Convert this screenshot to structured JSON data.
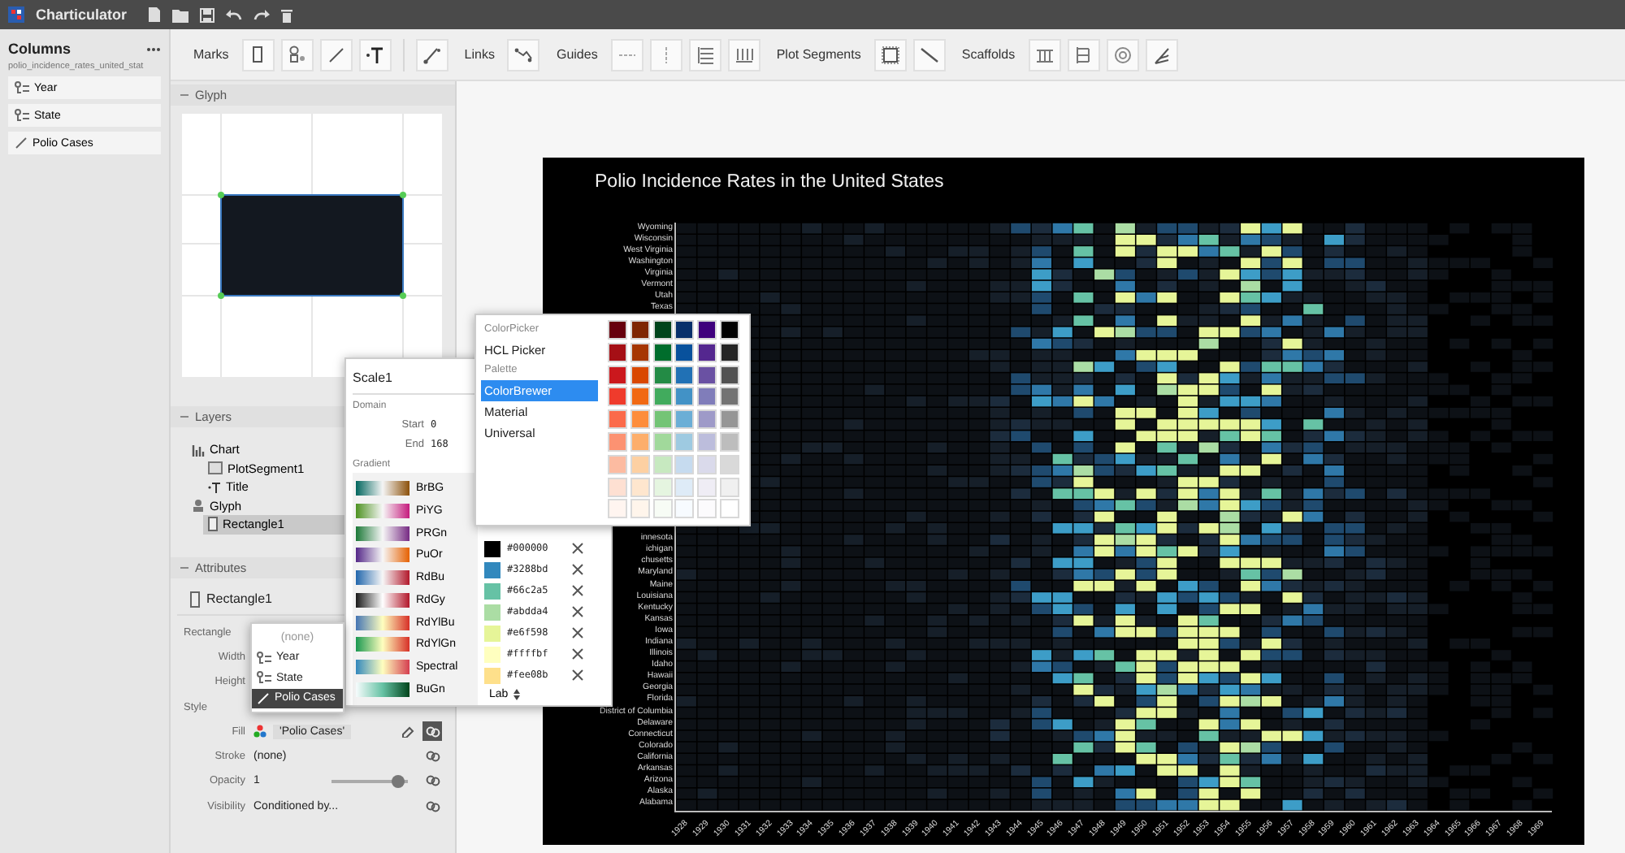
{
  "app": {
    "title": "Charticulator"
  },
  "columns_panel": {
    "title": "Columns",
    "dataset": "polio_incidence_rates_united_stat",
    "columns": [
      {
        "name": "Year",
        "kind": "categorical"
      },
      {
        "name": "State",
        "kind": "categorical"
      },
      {
        "name": "Polio Cases",
        "kind": "numerical"
      }
    ]
  },
  "toolbar": {
    "groups": [
      "Marks",
      "Links",
      "Guides",
      "Plot Segments",
      "Scaffolds"
    ]
  },
  "glyph_panel": {
    "title": "Glyph"
  },
  "layers_panel": {
    "title": "Layers",
    "items": [
      {
        "label": "Chart",
        "kind": "chart",
        "selected": false,
        "children": [
          {
            "label": "PlotSegment1",
            "kind": "plot-segment",
            "selected": false
          },
          {
            "label": "Title",
            "kind": "text",
            "selected": false
          }
        ]
      },
      {
        "label": "Glyph",
        "kind": "glyph",
        "selected": false,
        "children": [
          {
            "label": "Rectangle1",
            "kind": "rectangle",
            "selected": true
          }
        ]
      }
    ]
  },
  "attributes_panel": {
    "title": "Attributes",
    "object": "Rectangle1",
    "rows": [
      {
        "label": "Rectangle",
        "kind": "group"
      },
      {
        "label": "Width",
        "kind": "field"
      },
      {
        "label": "Height",
        "kind": "field"
      },
      {
        "label": "Style",
        "kind": "group"
      },
      {
        "label": "Fill",
        "kind": "mapping",
        "value": "'Polio Cases'",
        "bound": true
      },
      {
        "label": "Stroke",
        "kind": "text",
        "value": "(none)",
        "bound": false
      },
      {
        "label": "Opacity",
        "kind": "slider",
        "value": "1",
        "level": 0.88,
        "bound": false
      },
      {
        "label": "Visibility",
        "kind": "text",
        "value": "Conditioned by...",
        "bound": false
      }
    ]
  },
  "column_menu": {
    "items": [
      {
        "label": "(none)",
        "kind": "none",
        "selected": false
      },
      {
        "label": "Year",
        "kind": "categorical",
        "selected": false
      },
      {
        "label": "State",
        "kind": "categorical",
        "selected": false
      },
      {
        "label": "Polio Cases",
        "kind": "numerical",
        "selected": true
      }
    ]
  },
  "scale_editor": {
    "title": "Scale1",
    "domain_label": "Domain",
    "start_label": "Start",
    "start": "0",
    "end_label": "End",
    "end": "168",
    "gradient_label": "Gradient",
    "gradients": [
      {
        "name": "BrBG"
      },
      {
        "name": "PiYG"
      },
      {
        "name": "PRGn"
      },
      {
        "name": "PuOr"
      },
      {
        "name": "RdBu"
      },
      {
        "name": "RdGy"
      },
      {
        "name": "RdYlBu"
      },
      {
        "name": "RdYlGn"
      },
      {
        "name": "Spectral"
      },
      {
        "name": "BuGn"
      }
    ],
    "stops": [
      {
        "label": "#000000",
        "color": "#000000"
      },
      {
        "label": "#3288bd",
        "color": "#3288bd"
      },
      {
        "label": "#66c2a5",
        "color": "#66c2a5"
      },
      {
        "label": "#abdda4",
        "color": "#abdda4"
      },
      {
        "label": "#e6f598",
        "color": "#e6f598"
      },
      {
        "label": "#ffffbf",
        "color": "#ffffbf"
      },
      {
        "label": "#fee08b",
        "color": "#fee08b"
      }
    ],
    "interpolation": "Lab"
  },
  "color_picker": {
    "menu": [
      {
        "label": "ColorPicker",
        "kind": "header"
      },
      {
        "label": "HCL Picker",
        "kind": "item",
        "selected": false
      },
      {
        "label": "Palette",
        "kind": "header"
      },
      {
        "label": "ColorBrewer",
        "kind": "item",
        "selected": true
      },
      {
        "label": "Material",
        "kind": "item",
        "selected": false
      },
      {
        "label": "Universal",
        "kind": "item",
        "selected": false
      }
    ],
    "rows": [
      {
        "swatches": [
          {
            "color": "#67000d"
          },
          {
            "color": "#7f2704"
          },
          {
            "color": "#00441b"
          },
          {
            "color": "#08306b"
          },
          {
            "color": "#3f007d"
          },
          {
            "color": "#000000"
          }
        ]
      },
      {
        "swatches": [
          {
            "color": "#a50f15"
          },
          {
            "color": "#a63603"
          },
          {
            "color": "#006d2c"
          },
          {
            "color": "#08519c"
          },
          {
            "color": "#54278f"
          },
          {
            "color": "#252525"
          }
        ]
      },
      {
        "swatches": [
          {
            "color": "#cb181d"
          },
          {
            "color": "#d94801"
          },
          {
            "color": "#238b45"
          },
          {
            "color": "#2171b5"
          },
          {
            "color": "#6a51a3"
          },
          {
            "color": "#525252"
          }
        ]
      },
      {
        "swatches": [
          {
            "color": "#ef3b2c"
          },
          {
            "color": "#f16913"
          },
          {
            "color": "#41ab5d"
          },
          {
            "color": "#4292c6"
          },
          {
            "color": "#807dba"
          },
          {
            "color": "#737373"
          }
        ]
      },
      {
        "swatches": [
          {
            "color": "#fb6a4a"
          },
          {
            "color": "#fd8d3c"
          },
          {
            "color": "#74c476"
          },
          {
            "color": "#6baed6"
          },
          {
            "color": "#9e9ac8"
          },
          {
            "color": "#969696"
          }
        ]
      },
      {
        "swatches": [
          {
            "color": "#fc9272"
          },
          {
            "color": "#fdae6b"
          },
          {
            "color": "#a1d99b"
          },
          {
            "color": "#9ecae1"
          },
          {
            "color": "#bcbddc"
          },
          {
            "color": "#bdbdbd"
          }
        ]
      },
      {
        "swatches": [
          {
            "color": "#fcbba1"
          },
          {
            "color": "#fdd0a2"
          },
          {
            "color": "#c7e9c0"
          },
          {
            "color": "#c6dbef"
          },
          {
            "color": "#dadaeb"
          },
          {
            "color": "#d9d9d9"
          }
        ]
      },
      {
        "swatches": [
          {
            "color": "#fee0d2"
          },
          {
            "color": "#fee6ce"
          },
          {
            "color": "#e5f5e0"
          },
          {
            "color": "#deebf7"
          },
          {
            "color": "#efedf5"
          },
          {
            "color": "#f0f0f0"
          }
        ]
      },
      {
        "swatches": [
          {
            "color": "#fff5f0"
          },
          {
            "color": "#fff5eb"
          },
          {
            "color": "#f7fcf5"
          },
          {
            "color": "#f7fbff"
          },
          {
            "color": "#fcfbfd"
          },
          {
            "color": "#ffffff"
          }
        ]
      }
    ]
  },
  "chart": {
    "title": "Polio Incidence Rates in the United States",
    "y_labels_top": [
      "Wyoming",
      "Wisconsin",
      "West Virginia",
      "Washington",
      "Virginia",
      "Vermont",
      "Utah",
      "Texas"
    ],
    "y_labels_bottom": [
      "innesota",
      "ichigan",
      "chusetts",
      "Maryland",
      "Maine",
      "Louisiana",
      "Kentucky",
      "Kansas",
      "Iowa",
      "Indiana",
      "Illinois",
      "Idaho",
      "Hawaii",
      "Georgia",
      "Florida",
      "District of Columbia",
      "Delaware",
      "Connecticut",
      "Colorado",
      "California",
      "Arkansas",
      "Arizona",
      "Alaska",
      "Alabama"
    ],
    "x_labels": [
      "1928",
      "1929",
      "1930",
      "1931",
      "1932",
      "1933",
      "1934",
      "1935",
      "1936",
      "1937",
      "1938",
      "1939",
      "1940",
      "1941",
      "1942",
      "1943",
      "1944",
      "1945",
      "1946",
      "1947",
      "1948",
      "1949",
      "1950",
      "1951",
      "1952",
      "1953",
      "1954",
      "1955",
      "1956",
      "1957",
      "1958",
      "1959",
      "1960",
      "1961",
      "1962",
      "1963",
      "1964",
      "1965",
      "1966",
      "1967",
      "1968",
      "1969"
    ]
  }
}
